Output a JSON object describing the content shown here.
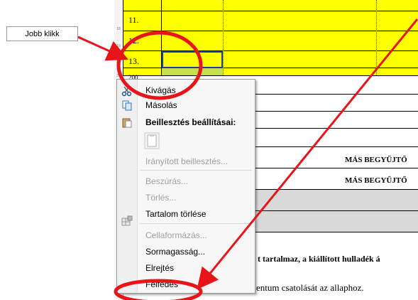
{
  "callout": {
    "text": "Jobb klikk"
  },
  "rows": [
    {
      "num": "11."
    },
    {
      "num": "12."
    },
    {
      "num": "13."
    },
    {
      "num": "200"
    }
  ],
  "sheet": {
    "text_mas1": "MÁS BEGYŰJTŐ",
    "text_mas2": "MÁS BEGYŰJTŐ",
    "text_bold_line": "t tartalmaz, a kiállított hulladék á",
    "text_normal_line": "entum csatolását az allaphoz."
  },
  "menu": {
    "items": [
      {
        "label": "Kivágás",
        "icon": "scissors-icon",
        "disabled": false
      },
      {
        "label": "Másolás",
        "icon": "copy-icon",
        "disabled": false
      },
      {
        "label": "Beillesztés beállításai:",
        "icon": "paste-icon",
        "disabled": false,
        "bold": true
      },
      {
        "label": "Irányított beillesztés...",
        "disabled": true
      },
      {
        "label": "Beszúrás...",
        "disabled": true
      },
      {
        "label": "Törlés...",
        "disabled": true
      },
      {
        "label": "Tartalom törlése",
        "disabled": false
      },
      {
        "label": "Cellaformázás...",
        "icon": "format-cells-icon",
        "disabled": true
      },
      {
        "label": "Sormagasság...",
        "disabled": false
      },
      {
        "label": "Elrejtés",
        "disabled": false
      },
      {
        "label": "Felfedés",
        "disabled": false
      }
    ]
  },
  "colors": {
    "annotation": "#e8141a",
    "highlight": "#ffff00",
    "selection": "#1f3fa8"
  }
}
